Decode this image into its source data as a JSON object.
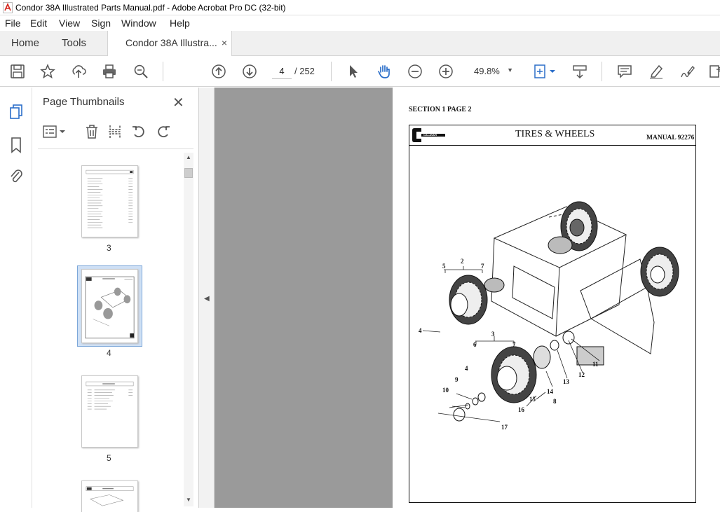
{
  "window": {
    "title": "Condor 38A Illustrated Parts Manual.pdf - Adobe Acrobat Pro DC (32-bit)"
  },
  "menu": [
    "File",
    "Edit",
    "View",
    "Sign",
    "Window",
    "Help"
  ],
  "tabs": {
    "home": "Home",
    "tools": "Tools",
    "document": "Condor 38A Illustra...",
    "close_glyph": "×"
  },
  "toolbar": {
    "page_current": "4",
    "page_total": "/  252",
    "zoom": "49.8%",
    "icons": [
      "save-icon",
      "bookmark-star-icon",
      "upload-icon",
      "print-icon",
      "find-icon",
      "prev-page-icon",
      "next-page-icon",
      "select-cursor-icon",
      "hand-tool-icon",
      "zoom-out-icon",
      "zoom-in-icon",
      "fit-page-icon",
      "scroll-mode-icon",
      "comment-icon",
      "highlight-icon",
      "sign-icon",
      "more-tools-icon"
    ]
  },
  "thumbnails_panel": {
    "title": "Page Thumbnails",
    "close_glyph": "✕",
    "thumbnails": [
      {
        "label": "3",
        "selected": false
      },
      {
        "label": "4",
        "selected": true
      },
      {
        "label": "5",
        "selected": false
      }
    ]
  },
  "document_page": {
    "section_header": "SECTION 1 PAGE 2",
    "title": "TIRES & WHEELS",
    "manual_no": "MANUAL 92276",
    "logo_text": "CALAVAR",
    "callouts": [
      "2",
      "5",
      "7",
      "4",
      "3",
      "6",
      "7",
      "4",
      "9",
      "10",
      "16",
      "15",
      "17",
      "14",
      "8",
      "13",
      "12",
      "11"
    ]
  },
  "colors": {
    "accent_blue": "#2b6ec9",
    "pdf_red": "#d4231a",
    "doc_background": "#9a9a9a"
  }
}
